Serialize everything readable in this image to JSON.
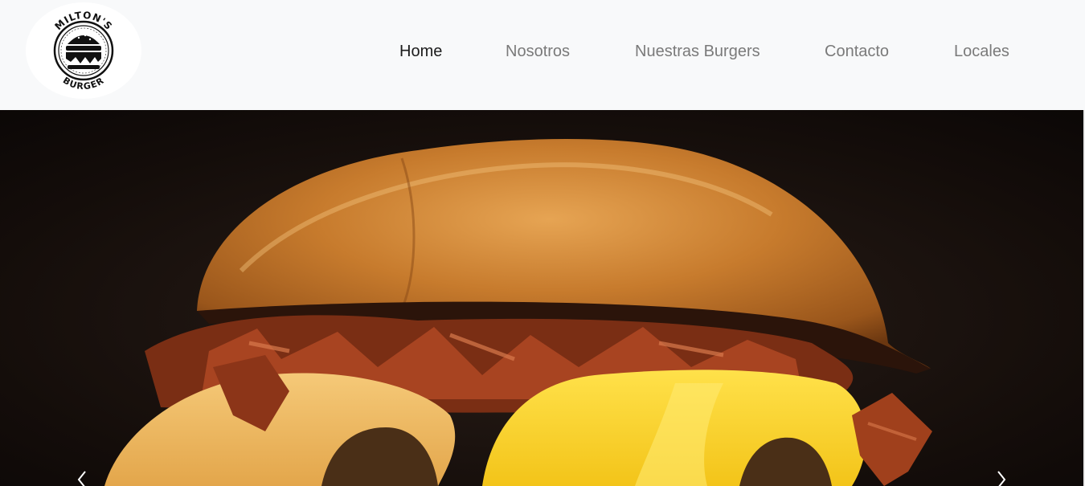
{
  "header": {
    "logo": {
      "alt": "Milton's Burger logo",
      "text_top": "MILTON'S",
      "text_bottom": "BURGER"
    },
    "nav": [
      {
        "label": "Home",
        "active": true
      },
      {
        "label": "Nosotros",
        "active": false
      },
      {
        "label": "Nuestras Burgers",
        "active": false
      },
      {
        "label": "Contacto",
        "active": false
      },
      {
        "label": "Locales",
        "active": false
      }
    ]
  },
  "carousel": {
    "slide_description": "Close-up of a bacon cheeseburger with melted cheese on a brioche bun",
    "prev_icon": "chevron-left-icon",
    "next_icon": "chevron-right-icon"
  },
  "colors": {
    "nav_bg": "#f8f9fa",
    "nav_active": "#1c1c1c",
    "nav_inactive": "#7a7a7a",
    "hero_bg": "#120c0a"
  }
}
